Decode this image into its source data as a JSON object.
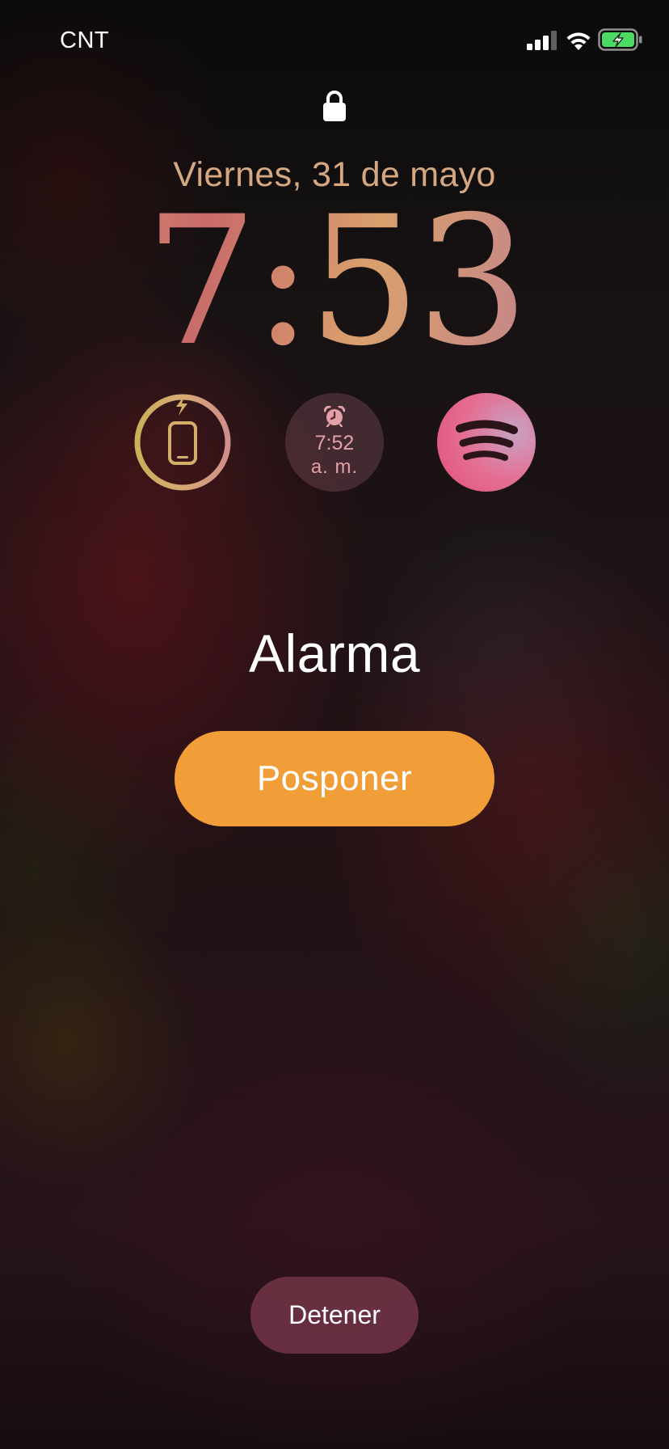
{
  "status_bar": {
    "carrier": "CNT",
    "signal_bars_active": 3,
    "signal_bars_total": 4,
    "wifi": "wifi-icon",
    "battery_state": "charging",
    "battery_color": "#4cd964"
  },
  "lock_screen": {
    "lock_icon": "lock-icon",
    "date": "Viernes, 31 de mayo",
    "time": "7:53"
  },
  "widgets": {
    "battery": {
      "icon": "phone-charging-icon",
      "ring_color": "#cfb05c"
    },
    "alarm": {
      "icon": "alarm-clock-icon",
      "time": "7:52",
      "period": "a. m."
    },
    "spotify": {
      "icon": "spotify-icon"
    }
  },
  "alarm_alert": {
    "title": "Alarma",
    "snooze_label": "Posponer",
    "stop_label": "Detener",
    "accent_color": "#f19d38"
  }
}
